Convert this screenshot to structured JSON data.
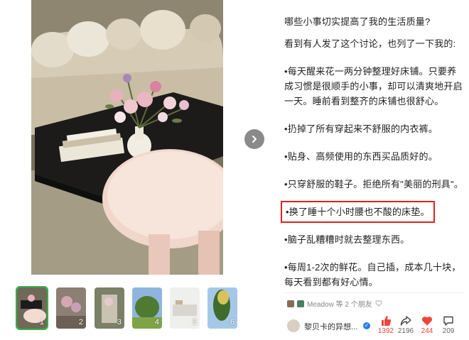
{
  "post": {
    "question": "哪些小事切实提高了我的生活质量?",
    "paragraphs": [
      "看到有人发了这个讨论，也列了一下我的:",
      "•每天醒来花一两分钟整理好床铺。只要养成习惯是很顺手的小事，却可以清爽地开启一天。睡前看到整齐的床铺也很舒心。",
      "•扔掉了所有穿起来不舒服的内衣裤。",
      "•贴身、高频使用的东西买品质好的。",
      "•只穿舒服的鞋子。拒绝所有\"美丽的刑具\"。",
      "•换了睡十个小时腰也不酸的床垫。",
      "•脑子乱糟糟时就去整理东西。",
      "•每周1-2次的鲜花。自己插，成本几十块，每天看到都有好心情。"
    ],
    "highlighted_index": 5
  },
  "gallery": {
    "next_icon": "chevron-right-icon",
    "thumbnails": [
      "1",
      "2",
      "3",
      "4",
      "5",
      "6"
    ],
    "active_index": 0
  },
  "likers": {
    "text": "Meadow 等 2 个朋友"
  },
  "author": {
    "name": "黎贝卡的异想..."
  },
  "actions": {
    "like": "1392",
    "share": "2196",
    "favorite": "244",
    "comment": "209"
  },
  "colors": {
    "highlight_border": "#e02020",
    "active_thumb": "#35b04a",
    "like_red": "#f0453a"
  }
}
